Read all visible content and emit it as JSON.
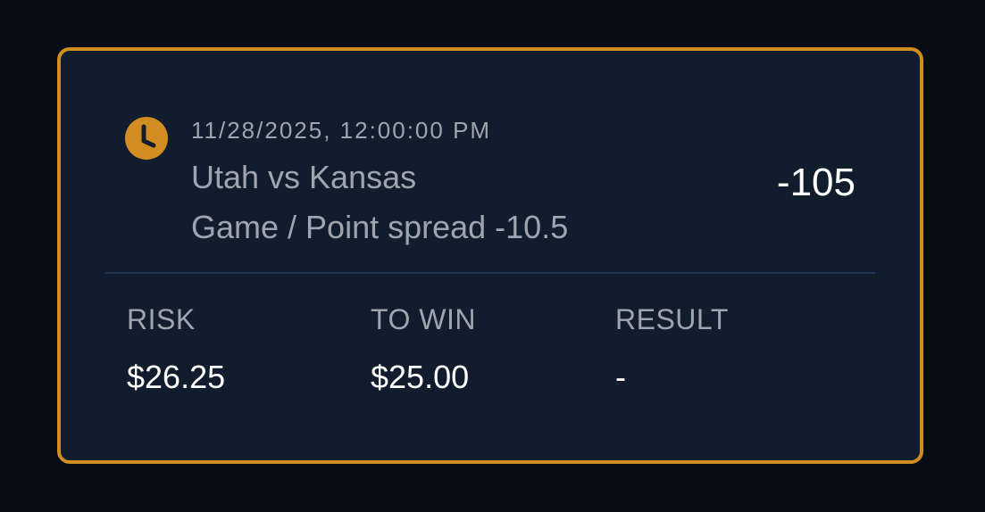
{
  "bet": {
    "datetime": "11/28/2025, 12:00:00 PM",
    "matchup": "Utah vs Kansas",
    "market": "Game / Point spread -10.5",
    "odds": "-105",
    "icon": "clock-icon"
  },
  "summary": {
    "risk_label": "RISK",
    "risk_value": "$26.25",
    "to_win_label": "TO WIN",
    "to_win_value": "$25.00",
    "result_label": "RESULT",
    "result_value": "-"
  },
  "colors": {
    "accent": "#d28d22",
    "card_background": "#111c2d",
    "page_background": "#060d17",
    "muted_text": "#9ea5ae",
    "primary_text": "#ffffff",
    "divider": "#1d3656"
  }
}
